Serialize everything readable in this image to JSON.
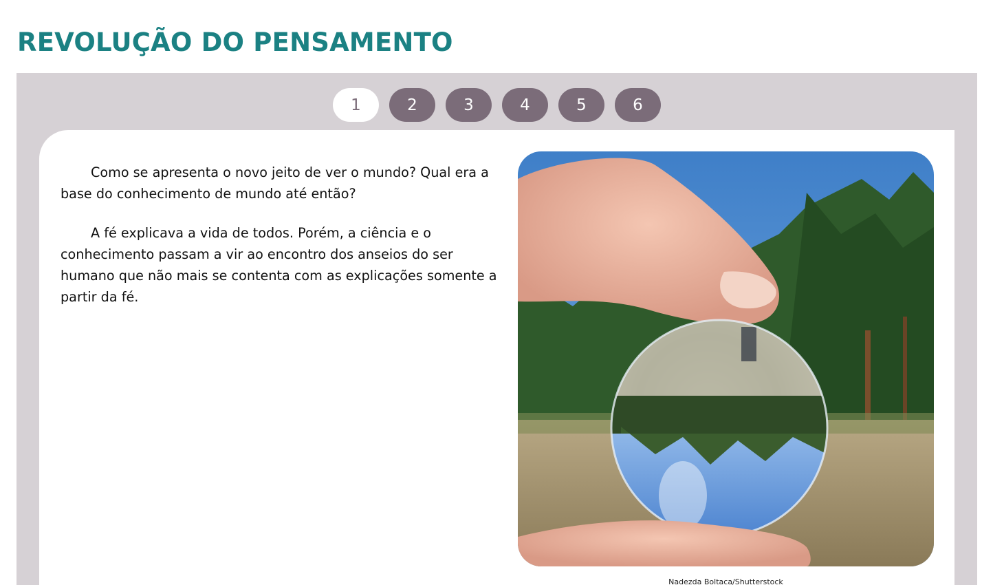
{
  "header": {
    "title": "REVOLUÇÃO DO PENSAMENTO"
  },
  "pager": {
    "pages": [
      "1",
      "2",
      "3",
      "4",
      "5",
      "6"
    ],
    "active": "1"
  },
  "content": {
    "paragraphs": [
      "Como se apresenta o novo jeito de ver o mundo? Qual era a base do conhecimento de mundo até então?",
      "A fé explicava a vida de todos. Porém, a ciência e o conhecimento passam a vir ao encontro dos anseios do ser humano que não mais se contenta com as explicações somente a partir da fé."
    ]
  },
  "image": {
    "subject": "hand-holding-crystal-ball-forest",
    "credit": "Nadezda Boltaca/Shutterstock"
  },
  "colors": {
    "title": "#1b8183",
    "panel": "#d6d1d5",
    "pill": "#7b6c79",
    "pill_active": "#ffffff"
  }
}
